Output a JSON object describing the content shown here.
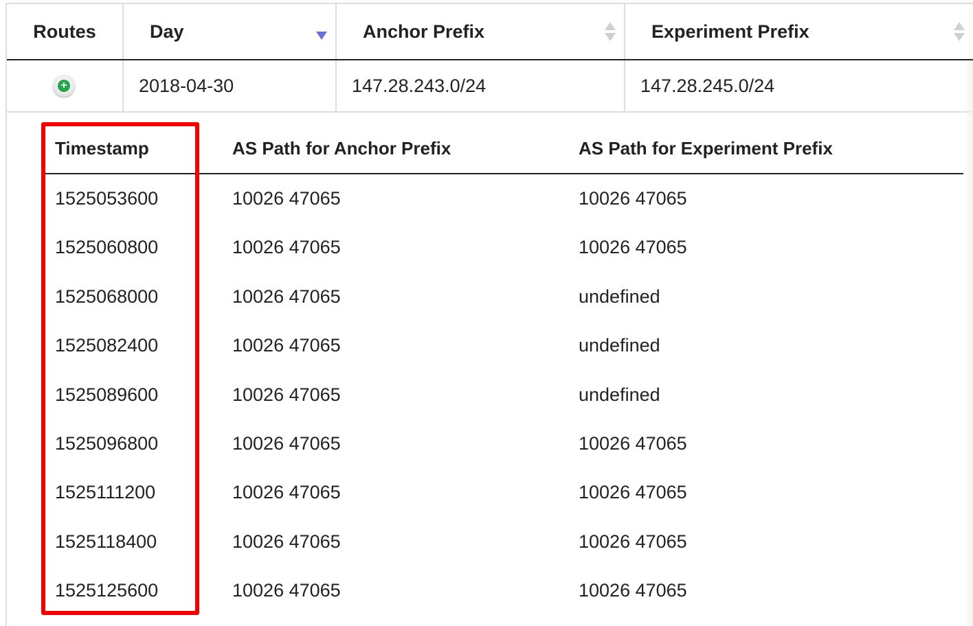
{
  "main_table": {
    "headers": {
      "routes": "Routes",
      "day": "Day",
      "anchor_prefix": "Anchor Prefix",
      "experiment_prefix": "Experiment Prefix"
    },
    "row": {
      "expand_icon": "plus-circle-icon",
      "day": "2018-04-30",
      "anchor_prefix": "147.28.243.0/24",
      "experiment_prefix": "147.28.245.0/24"
    }
  },
  "nested_table": {
    "headers": {
      "timestamp": "Timestamp",
      "anchor_path": "AS Path for Anchor Prefix",
      "experiment_path": "AS Path for Experiment Prefix"
    },
    "rows": [
      {
        "timestamp": "1525053600",
        "anchor_path": "10026 47065",
        "experiment_path": "10026 47065"
      },
      {
        "timestamp": "1525060800",
        "anchor_path": "10026 47065",
        "experiment_path": "10026 47065"
      },
      {
        "timestamp": "1525068000",
        "anchor_path": "10026 47065",
        "experiment_path": "undefined"
      },
      {
        "timestamp": "1525082400",
        "anchor_path": "10026 47065",
        "experiment_path": "undefined"
      },
      {
        "timestamp": "1525089600",
        "anchor_path": "10026 47065",
        "experiment_path": "undefined"
      },
      {
        "timestamp": "1525096800",
        "anchor_path": "10026 47065",
        "experiment_path": "10026 47065"
      },
      {
        "timestamp": "1525111200",
        "anchor_path": "10026 47065",
        "experiment_path": "10026 47065"
      },
      {
        "timestamp": "1525118400",
        "anchor_path": "10026 47065",
        "experiment_path": "10026 47065"
      },
      {
        "timestamp": "1525125600",
        "anchor_path": "10026 47065",
        "experiment_path": "10026 47065"
      }
    ]
  },
  "colors": {
    "highlight": "#f40000",
    "sort_active": "#6b6fd6",
    "expand_green": "#22a84a"
  }
}
